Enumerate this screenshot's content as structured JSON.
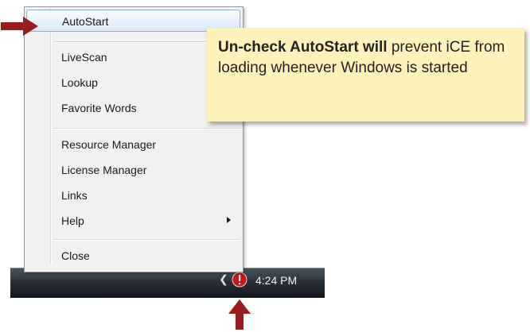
{
  "menu": {
    "items": [
      {
        "label": "AutoStart"
      },
      {
        "label": "LiveScan"
      },
      {
        "label": "Lookup"
      },
      {
        "label": "Favorite Words"
      },
      {
        "label": "Resource Manager"
      },
      {
        "label": "License Manager"
      },
      {
        "label": "Links"
      },
      {
        "label": "Help"
      },
      {
        "label": "Close"
      }
    ],
    "highlighted_item": "AutoStart",
    "highlight_color": "#d9e8f8"
  },
  "callout": {
    "bold_text": "Un-check AutoStart will",
    "text": " prevent iCE from loading whenever Windows is started",
    "background_color": "#fdf3b8"
  },
  "taskbar": {
    "clock": "4:24 PM",
    "tray_icons": [
      "chevron-left-icon",
      "ice-app-icon"
    ]
  },
  "annotations": {
    "arrow_color": "#9b1c1c"
  }
}
